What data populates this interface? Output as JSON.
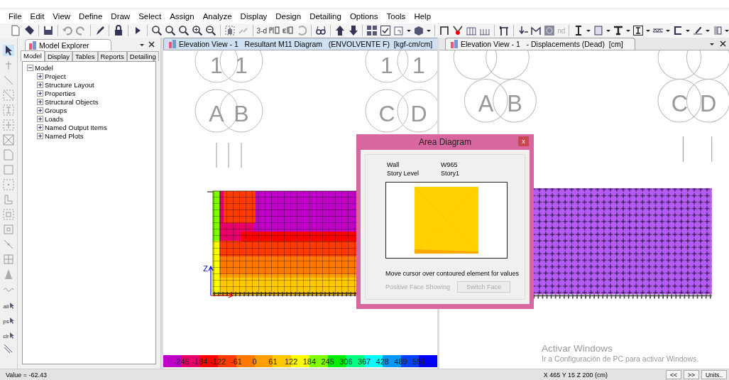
{
  "menu": [
    {
      "label": "File"
    },
    {
      "label": "Edit"
    },
    {
      "label": "View"
    },
    {
      "label": "Define"
    },
    {
      "label": "Draw"
    },
    {
      "label": "Select"
    },
    {
      "label": "Assign"
    },
    {
      "label": "Analyze"
    },
    {
      "label": "Display"
    },
    {
      "label": "Design"
    },
    {
      "label": "Detailing"
    },
    {
      "label": "Options"
    },
    {
      "label": "Tools"
    },
    {
      "label": "Help"
    }
  ],
  "toolbar": {
    "labels": [
      "3-d",
      "nd"
    ]
  },
  "side_toolbar": {
    "labels": [
      "all",
      "ps",
      "clr"
    ]
  },
  "model_explorer": {
    "title": "Model Explorer",
    "tabs": [
      {
        "label": "Model",
        "selected": true
      },
      {
        "label": "Display",
        "selected": false
      },
      {
        "label": "Tables",
        "selected": false
      },
      {
        "label": "Reports",
        "selected": false
      },
      {
        "label": "Detailing",
        "selected": false
      }
    ],
    "tree": {
      "label": "Model",
      "expanded": true,
      "children": [
        {
          "label": "Project",
          "expanded": false
        },
        {
          "label": "Structure Layout",
          "expanded": false
        },
        {
          "label": "Properties",
          "expanded": false
        },
        {
          "label": "Structural Objects",
          "expanded": false
        },
        {
          "label": "Groups",
          "expanded": false
        },
        {
          "label": "Loads",
          "expanded": false
        },
        {
          "label": "Named Output Items",
          "expanded": false
        },
        {
          "label": "Named Plots",
          "expanded": false
        }
      ]
    }
  },
  "views": [
    {
      "kind": "contour",
      "title": "Elevation View - 1   Resultant M11 Diagram   (ENVOLVENTE F)  [kgf-cm/cm]",
      "active": true,
      "grid_labels": [
        "1",
        "1",
        "1",
        "1",
        "A",
        "B",
        "C",
        "D"
      ],
      "axis_label": "Z"
    },
    {
      "kind": "displacement",
      "title": "Elevation View - 1   - Displacements (Dead)  [cm]",
      "active": false,
      "grid_labels": [
        "A",
        "B",
        "C",
        "D"
      ]
    }
  ],
  "legend": {
    "segments": [
      {
        "color": "#c000c8"
      },
      {
        "color": "#e8006a"
      },
      {
        "color": "#ff0000"
      },
      {
        "color": "#ff3c00"
      },
      {
        "color": "#ff7800"
      },
      {
        "color": "#ffa000"
      },
      {
        "color": "#ffc800"
      },
      {
        "color": "#ffff00"
      },
      {
        "color": "#80ff00"
      },
      {
        "color": "#00f000"
      },
      {
        "color": "#00ff80"
      },
      {
        "color": "#00ffff"
      },
      {
        "color": "#0098ff"
      },
      {
        "color": "#0040ff"
      },
      {
        "color": "#0000ff"
      }
    ],
    "labels": [
      "-245",
      "-184",
      "-122",
      "-61",
      "0",
      "61",
      "122",
      "184",
      "245",
      "306",
      "367",
      "428",
      "489",
      "551"
    ]
  },
  "dialog": {
    "title": "Area Diagram",
    "close": "x",
    "fields": [
      {
        "label": "Wall",
        "value": "W965"
      },
      {
        "label": "Story Level",
        "value": "Story1"
      }
    ],
    "message": "Move cursor over contoured element for values",
    "face_label": {
      "text": "Positive Face Showing",
      "disabled": true
    },
    "switch_button": {
      "label": "Switch Face",
      "disabled": true
    }
  },
  "status_bar": {
    "value": "Value = -62.43",
    "coordinates": "X 465  Y 15  Z 200 (cm)",
    "buttons": [
      "<<",
      ">>",
      "Units.."
    ]
  },
  "activation_notice": {
    "title": "Activar Windows",
    "text": "Ir a Configuración de PC para activar Windows."
  }
}
